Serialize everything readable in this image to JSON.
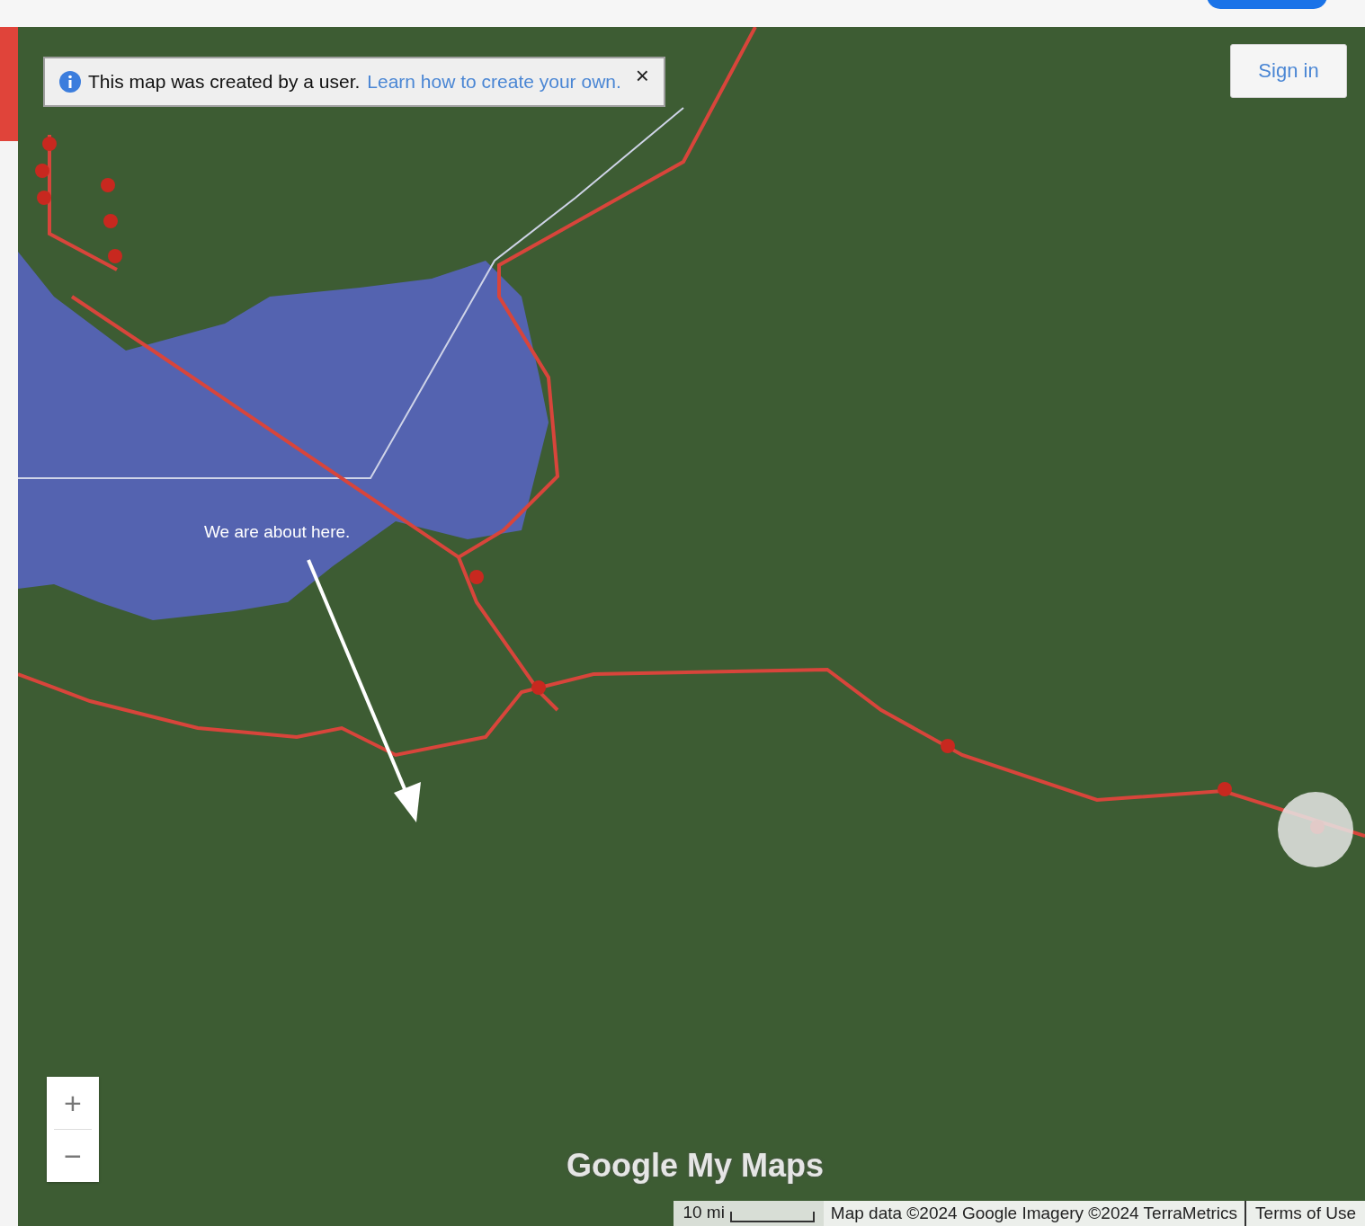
{
  "notice": {
    "text": "This map was created by a user.",
    "link": "Learn how to create your own.",
    "close": "×"
  },
  "sign_in": "Sign in",
  "annotation": "We are about here.",
  "zoom": {
    "in": "+",
    "out": "−"
  },
  "logo": "Google My Maps",
  "footer": {
    "scale": "10 mi",
    "attribution": "Map data ©2024 Google Imagery ©2024 TerraMetrics",
    "terms": "Terms of Use"
  }
}
